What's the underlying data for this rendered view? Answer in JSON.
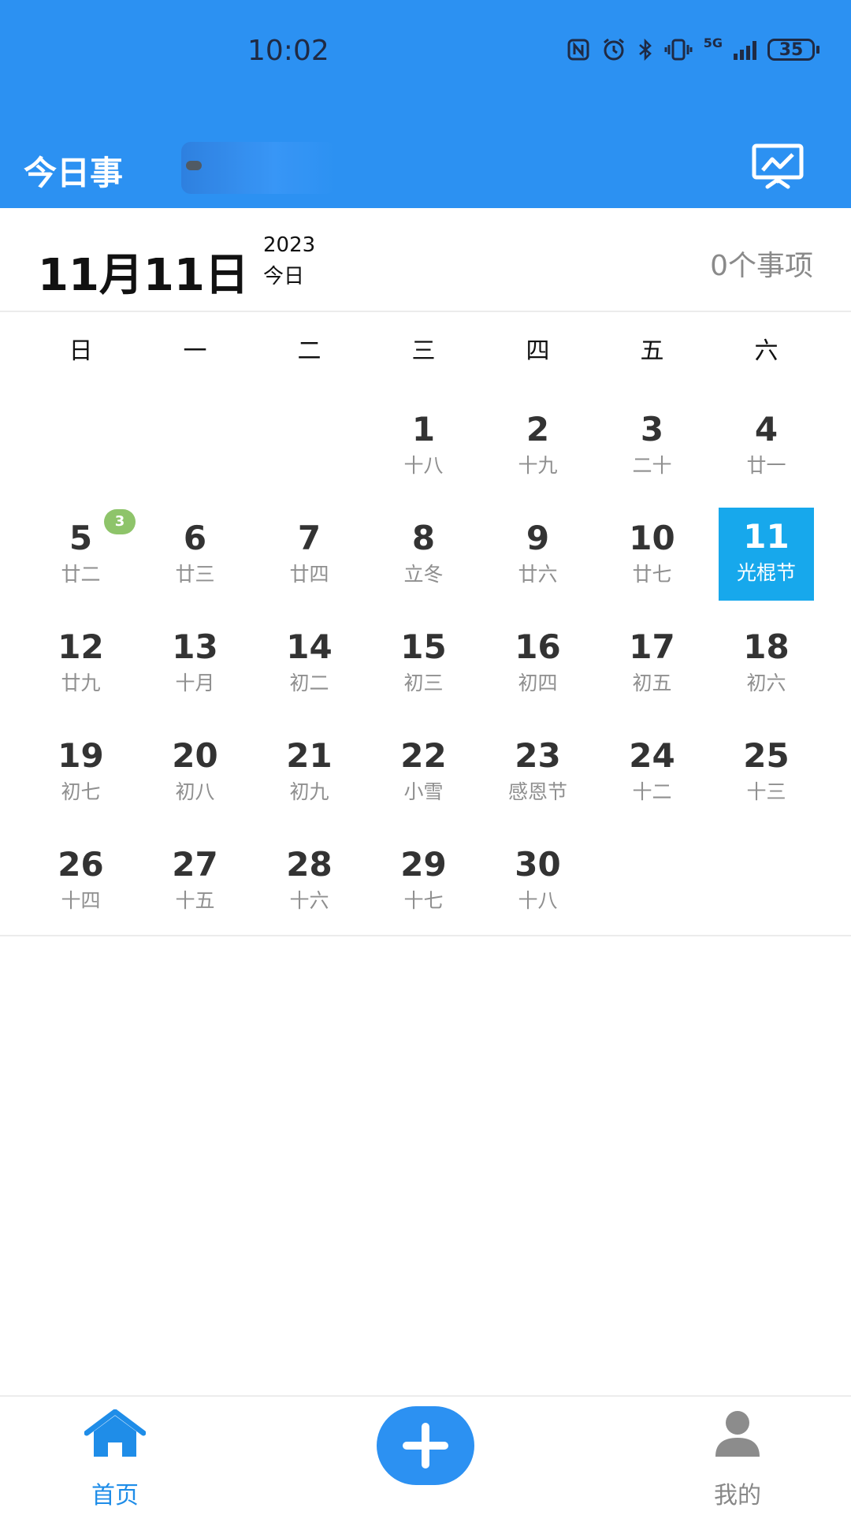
{
  "status_bar": {
    "time": "10:02",
    "net_label": "5G",
    "battery": "35",
    "icons": [
      "nfc-icon",
      "alarm-icon",
      "bluetooth-icon",
      "vibrate-icon",
      "signal-icon",
      "battery-icon"
    ]
  },
  "header": {
    "title": "今日事",
    "stats_icon": "presentation-chart-icon"
  },
  "date_bar": {
    "date": "11月11日",
    "year": "2023",
    "today_label": "今日",
    "count": "0个事项"
  },
  "calendar": {
    "weekdays": [
      "日",
      "一",
      "二",
      "三",
      "四",
      "五",
      "六"
    ],
    "selected_day": "11",
    "days": [
      {
        "num": "1",
        "lunar": "十八"
      },
      {
        "num": "2",
        "lunar": "十九"
      },
      {
        "num": "3",
        "lunar": "二十"
      },
      {
        "num": "4",
        "lunar": "廿一"
      },
      {
        "num": "5",
        "lunar": "廿二",
        "badge": "3"
      },
      {
        "num": "6",
        "lunar": "廿三"
      },
      {
        "num": "7",
        "lunar": "廿四"
      },
      {
        "num": "8",
        "lunar": "立冬"
      },
      {
        "num": "9",
        "lunar": "廿六"
      },
      {
        "num": "10",
        "lunar": "廿七"
      },
      {
        "num": "11",
        "lunar": "光棍节"
      },
      {
        "num": "12",
        "lunar": "廿九"
      },
      {
        "num": "13",
        "lunar": "十月"
      },
      {
        "num": "14",
        "lunar": "初二"
      },
      {
        "num": "15",
        "lunar": "初三"
      },
      {
        "num": "16",
        "lunar": "初四"
      },
      {
        "num": "17",
        "lunar": "初五"
      },
      {
        "num": "18",
        "lunar": "初六"
      },
      {
        "num": "19",
        "lunar": "初七"
      },
      {
        "num": "20",
        "lunar": "初八"
      },
      {
        "num": "21",
        "lunar": "初九"
      },
      {
        "num": "22",
        "lunar": "小雪"
      },
      {
        "num": "23",
        "lunar": "感恩节"
      },
      {
        "num": "24",
        "lunar": "十二"
      },
      {
        "num": "25",
        "lunar": "十三"
      },
      {
        "num": "26",
        "lunar": "十四"
      },
      {
        "num": "27",
        "lunar": "十五"
      },
      {
        "num": "28",
        "lunar": "十六"
      },
      {
        "num": "29",
        "lunar": "十七"
      },
      {
        "num": "30",
        "lunar": "十八"
      }
    ]
  },
  "bottom_nav": {
    "home_label": "首页",
    "me_label": "我的",
    "add_icon": "plus-icon"
  },
  "colors": {
    "header_blue": "#2c91f2",
    "selected_day": "#17a8ec",
    "badge_green": "#8ec46a",
    "home_active": "#1f8de8"
  }
}
